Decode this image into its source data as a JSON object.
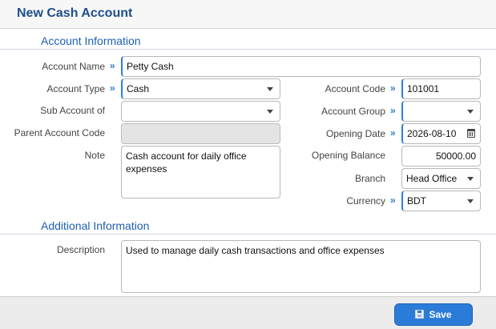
{
  "header": {
    "title": "New Cash Account"
  },
  "sections": {
    "account_info": "Account Information",
    "additional_info": "Additional Information"
  },
  "form": {
    "account_name": {
      "label": "Account Name",
      "value": "Petty Cash"
    },
    "account_type": {
      "label": "Account Type",
      "value": "Cash"
    },
    "sub_account_of": {
      "label": "Sub Account of",
      "value": ""
    },
    "parent_account_code": {
      "label": "Parent Account Code",
      "value": ""
    },
    "note": {
      "label": "Note",
      "value": "Cash account for daily office expenses"
    },
    "account_code": {
      "label": "Account Code",
      "value": "101001"
    },
    "account_group": {
      "label": "Account Group",
      "value": ""
    },
    "opening_date": {
      "label": "Opening Date",
      "value": "2026-08-10"
    },
    "opening_balance": {
      "label": "Opening Balance",
      "value": "50000.00"
    },
    "branch": {
      "label": "Branch",
      "value": "Head Office"
    },
    "currency": {
      "label": "Currency",
      "value": "BDT"
    },
    "description": {
      "label": "Description",
      "value": "Used to manage daily cash transactions and office expenses"
    }
  },
  "footer": {
    "save_label": "Save"
  },
  "required_marker": "»",
  "icons": {
    "dropdown": "chevron-down-icon",
    "calendar": "calendar-icon",
    "save": "floppy-disk-icon"
  },
  "colors": {
    "accent": "#2b7cd8",
    "title": "#1f4f8a",
    "section": "#1f5fb0"
  }
}
